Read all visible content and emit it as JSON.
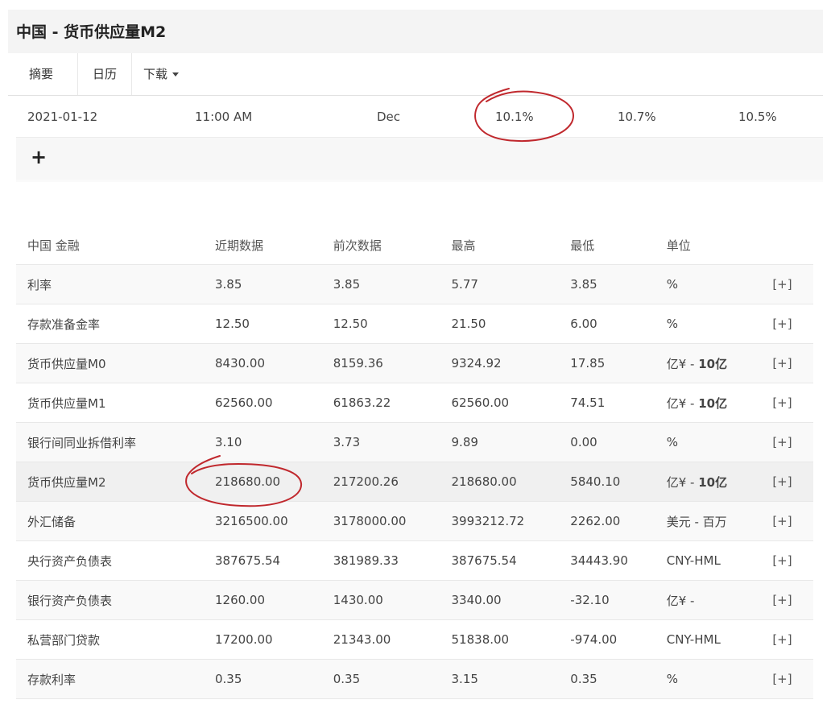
{
  "header": {
    "title": "中国 - 货币供应量M2"
  },
  "tabs": [
    {
      "label": "摘要"
    },
    {
      "label": "日历"
    },
    {
      "label": "下载"
    }
  ],
  "calendar": {
    "date": "2021-01-12",
    "time": "11:00 AM",
    "reference": "Dec",
    "actual": "10.1%",
    "forecast": "10.7%",
    "previous": "10.5%",
    "expand_label": "+"
  },
  "table": {
    "headers": [
      "中国 金融",
      "近期数据",
      "前次数据",
      "最高",
      "最低",
      "单位",
      ""
    ],
    "rows": [
      {
        "name": "利率",
        "latest": "3.85",
        "previous": "3.85",
        "high": "5.77",
        "low": "3.85",
        "unit": "%",
        "unit_suffix": "",
        "action": "[+]"
      },
      {
        "name": "存款准备金率",
        "latest": "12.50",
        "previous": "12.50",
        "high": "21.50",
        "low": "6.00",
        "unit": "%",
        "unit_suffix": "",
        "action": "[+]"
      },
      {
        "name": "货币供应量M0",
        "latest": "8430.00",
        "previous": "8159.36",
        "high": "9324.92",
        "low": "17.85",
        "unit": "亿¥ - ",
        "unit_suffix": "10亿",
        "action": "[+]"
      },
      {
        "name": "货币供应量M1",
        "latest": "62560.00",
        "previous": "61863.22",
        "high": "62560.00",
        "low": "74.51",
        "unit": "亿¥ - ",
        "unit_suffix": "10亿",
        "action": "[+]"
      },
      {
        "name": "银行间同业拆借利率",
        "latest": "3.10",
        "previous": "3.73",
        "high": "9.89",
        "low": "0.00",
        "unit": "%",
        "unit_suffix": "",
        "action": "[+]"
      },
      {
        "name": "货币供应量M2",
        "latest": "218680.00",
        "previous": "217200.26",
        "high": "218680.00",
        "low": "5840.10",
        "unit": "亿¥ - ",
        "unit_suffix": "10亿",
        "action": "[+]"
      },
      {
        "name": "外汇储备",
        "latest": "3216500.00",
        "previous": "3178000.00",
        "high": "3993212.72",
        "low": "2262.00",
        "unit": "美元 - 百万",
        "unit_suffix": "",
        "action": "[+]"
      },
      {
        "name": "央行资产负债表",
        "latest": "387675.54",
        "previous": "381989.33",
        "high": "387675.54",
        "low": "34443.90",
        "unit": "CNY-HML",
        "unit_suffix": "",
        "action": "[+]"
      },
      {
        "name": "银行资产负债表",
        "latest": "1260.00",
        "previous": "1430.00",
        "high": "3340.00",
        "low": "-32.10",
        "unit": "亿¥ -",
        "unit_suffix": "",
        "action": "[+]"
      },
      {
        "name": "私营部门贷款",
        "latest": "17200.00",
        "previous": "21343.00",
        "high": "51838.00",
        "low": "-974.00",
        "unit": "CNY-HML",
        "unit_suffix": "",
        "action": "[+]"
      },
      {
        "name": "存款利率",
        "latest": "0.35",
        "previous": "0.35",
        "high": "3.15",
        "low": "0.35",
        "unit": "%",
        "unit_suffix": "",
        "action": "[+]"
      }
    ]
  },
  "colors": {
    "annotation": "#c0282d",
    "title_bg": "#f4f4f4",
    "text": "#444444"
  }
}
